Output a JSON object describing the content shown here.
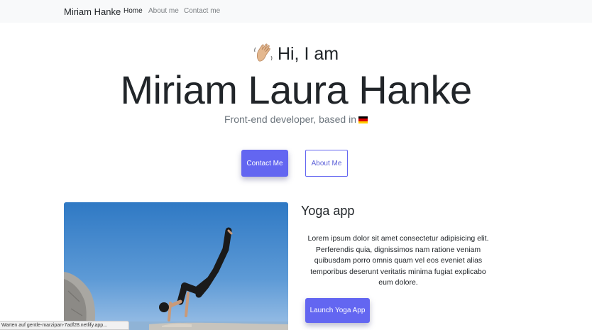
{
  "navbar": {
    "brand": "Miriam Hanke",
    "links": [
      {
        "label": "Home",
        "active": true
      },
      {
        "label": "About me",
        "active": false
      },
      {
        "label": "Contact me",
        "active": false
      }
    ]
  },
  "hero": {
    "greeting": "Hi, I am",
    "greeting_icon": "waving-hand-icon",
    "name": "Miriam Laura Hanke",
    "tagline": "Front-end developer, based in",
    "tagline_icon": "german-flag-icon"
  },
  "actions": {
    "contact_label": "Contact Me",
    "about_label": "About Me"
  },
  "project": {
    "image": "yoga-pose-photo",
    "title": "Yoga app",
    "description": "Lorem ipsum dolor sit amet consectetur adipisicing elit. Perferendis quia, dignissimos nam ratione veniam quibusdam porro omnis quam vel eos eveniet alias temporibus deserunt veritatis minima fugiat explicabo eum dolore.",
    "button_label": "Launch Yoga App"
  },
  "status_bar": {
    "text": "Warten auf gentle-marzipan-7adf28.netlify.app..."
  },
  "colors": {
    "accent": "#6366f1",
    "navbar_bg": "#f8f9fa",
    "text": "#212529",
    "muted": "#6c757d"
  }
}
